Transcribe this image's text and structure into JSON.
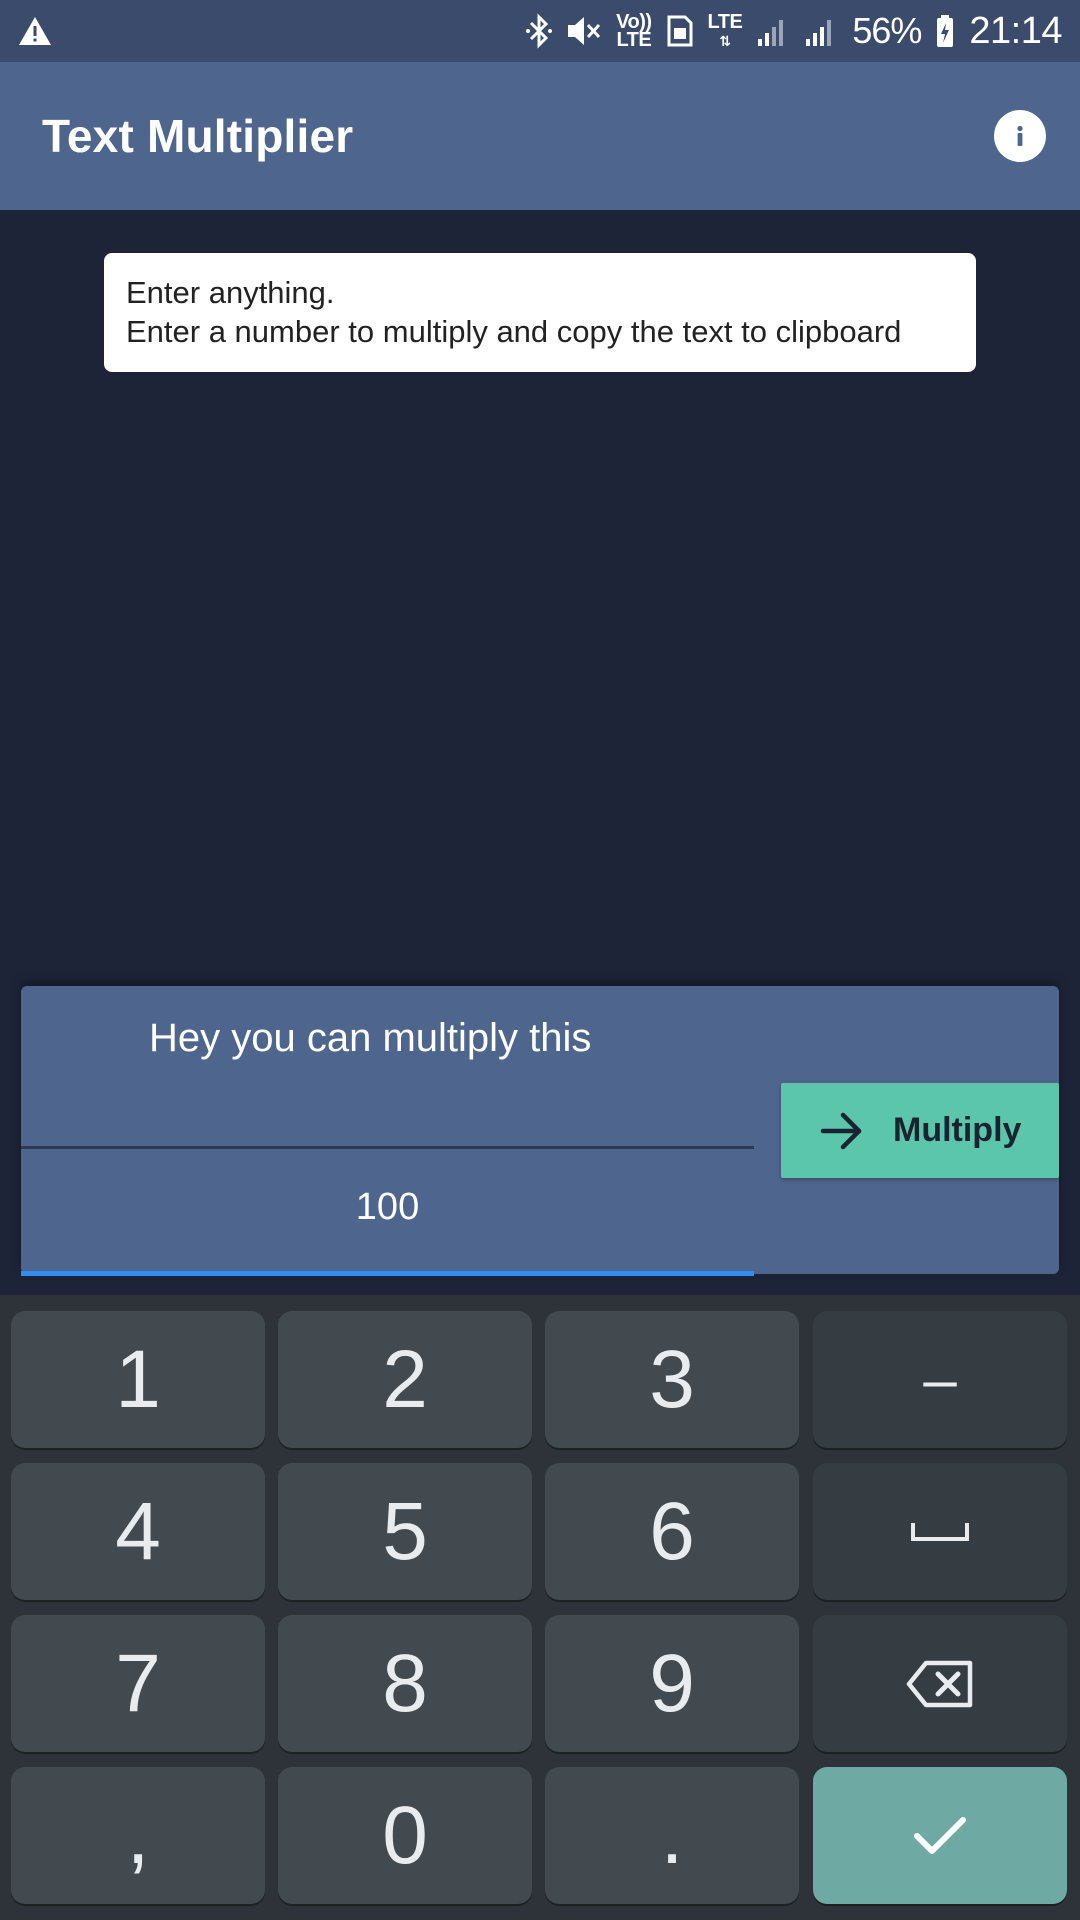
{
  "status_bar": {
    "battery": "56%",
    "time": "21:14",
    "volte_label_top": "Vo))",
    "volte_label_bottom": "LTE",
    "lte_label": "LTE",
    "icons": [
      "warning-icon",
      "bluetooth-icon",
      "mute-icon",
      "volte-icon",
      "sim-icon",
      "lte-icon",
      "signal-icon",
      "signal-icon",
      "battery-icon"
    ]
  },
  "app_bar": {
    "title": "Text Multiplier",
    "info_icon": "info-icon"
  },
  "hint_card": {
    "line1": "Enter anything.",
    "line2": "Enter a number to multiply and copy the text to clipboard"
  },
  "input_panel": {
    "text_value": "Hey you can multiply this",
    "number_value": "100",
    "multiply_label": "Multiply",
    "multiply_icon": "arrow-right-icon"
  },
  "keyboard": {
    "digits": [
      "1",
      "2",
      "3",
      "4",
      "5",
      "6",
      "7",
      "8",
      "9",
      "0"
    ],
    "minus": "–",
    "comma": ",",
    "dot": ".",
    "space_icon": "space-icon",
    "backspace_icon": "backspace-icon",
    "done_icon": "check-icon"
  },
  "colors": {
    "status_bar": "#3a4b6b",
    "app_bar": "#4e658d",
    "background": "#1e2438",
    "accent_button": "#5bc6ab",
    "focus_underline": "#2f8ef0",
    "key": "#42494f",
    "done_key": "#6ea9a3"
  }
}
